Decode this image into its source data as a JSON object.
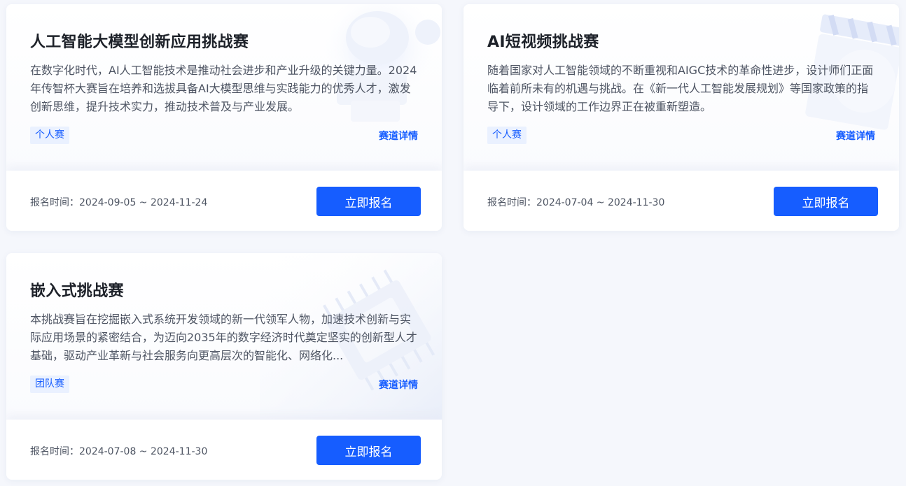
{
  "competitions": [
    {
      "title": "人工智能大模型创新应用挑战赛",
      "description": "在数字化时代，AI人工智能技术是推动社会进步和产业升级的关键力量。2024年传智杯大赛旨在培养和选拔具备AI大模型思维与实践能力的优秀人才，激发创新思维，提升技术实力，推动技术普及与产业发展。",
      "tag": "个人赛",
      "detail_link": "赛道详情",
      "reg_label": "报名时间：",
      "reg_range": "2024-09-05 ~ 2024-11-24",
      "button": "立即报名"
    },
    {
      "title": "AI短视频挑战赛",
      "description": "随着国家对人工智能领域的不断重视和AIGC技术的革命性进步，设计师们正面临着前所未有的机遇与挑战。在《新一代人工智能发展规划》等国家政策的指导下，设计领域的工作边界正在被重新塑造。",
      "tag": "个人赛",
      "detail_link": "赛道详情",
      "reg_label": "报名时间：",
      "reg_range": "2024-07-04 ~ 2024-11-30",
      "button": "立即报名"
    },
    {
      "title": "嵌入式挑战赛",
      "description": "本挑战赛旨在挖掘嵌入式系统开发领域的新一代领军人物，加速技术创新与实际应用场景的紧密结合，为迈向2035年的数字经济时代奠定坚实的创新型人才基础，驱动产业革新与社会服务向更高层次的智能化、网络化...",
      "tag": "团队赛",
      "detail_link": "赛道详情",
      "reg_label": "报名时间：",
      "reg_range": "2024-07-08 ~ 2024-11-30",
      "button": "立即报名"
    }
  ],
  "colors": {
    "accent": "#165dff",
    "tag_bg": "#eaf1ff",
    "page_bg": "#f5f7fc",
    "title": "#1d2129",
    "text": "#4e5563"
  },
  "icons": [
    "ai-brain-decoration-icon",
    "clapperboard-decoration-icon",
    "chip-decoration-icon"
  ]
}
